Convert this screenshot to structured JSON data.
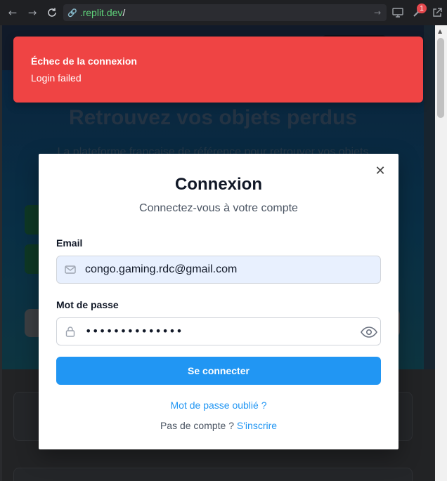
{
  "browser": {
    "url_domain": ".replit.dev",
    "url_path": "/",
    "notification_count": "1"
  },
  "background_page": {
    "title": "Retrouvez vos objets perdus",
    "subtitle": "La plateforme française de référence pour retrouver vos objets"
  },
  "toast": {
    "title": "Échec de la connexion",
    "description": "Login failed",
    "color": "#ef4444"
  },
  "modal": {
    "title": "Connexion",
    "subtitle": "Connectez-vous à votre compte",
    "email_label": "Email",
    "email_value": "congo.gaming.rdc@gmail.com",
    "password_label": "Mot de passe",
    "password_value": "••••••••••••••",
    "submit_label": "Se connecter",
    "forgot_label": "Mot de passe oublié ?",
    "no_account_text": "Pas de compte ? ",
    "signup_label": "S'inscrire",
    "accent_color": "#2196f3"
  }
}
